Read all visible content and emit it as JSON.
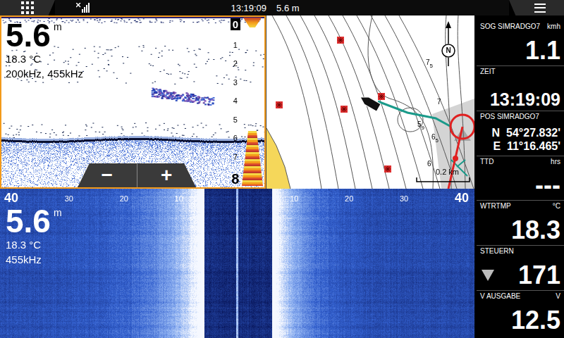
{
  "top_bar": {
    "time": "13:19:09",
    "depth": "5.6 m"
  },
  "sonar_panel": {
    "selected": true,
    "depth": "5.6",
    "depth_unit": "m",
    "water_temp": "18.3 °C",
    "frequency": "200kHz, 455kHz",
    "scale": [
      "0",
      "1",
      "2",
      "3",
      "4",
      "5",
      "6",
      "7",
      "8"
    ],
    "zoom_out": "−",
    "zoom_in": "+"
  },
  "chart_panel": {
    "selected": false,
    "north": "N",
    "soundings": [
      {
        "text": "7",
        "sub": "5"
      },
      {
        "text": "7"
      },
      {
        "text": "5",
        "sub": "9"
      },
      {
        "text": "6",
        "sub": "5"
      },
      {
        "text": "6"
      }
    ],
    "scale_bar": "0.2 km"
  },
  "sidescan_panel": {
    "selected": false,
    "range_left": "40",
    "ticks_left": [
      "30",
      "20",
      "10"
    ],
    "ticks_right": [
      "10",
      "20",
      "30"
    ],
    "range_right": "40",
    "depth": "5.6",
    "depth_unit": "m",
    "water_temp": "18.3 °C",
    "frequency": "455kHz"
  },
  "sidebar": {
    "fields": [
      {
        "label": "SOG SIMRADGO7",
        "unit": "kmh",
        "values": [
          "1.1"
        ],
        "kind": "number"
      },
      {
        "label": "ZEIT",
        "values": [
          "13:19:09"
        ],
        "kind": "time"
      },
      {
        "label": "POS SIMRADGO7",
        "values": [
          "N  54°27.832'",
          "E  11°16.465'"
        ],
        "kind": "position"
      },
      {
        "label": "TTD",
        "unit": "hrs",
        "values": [
          "---"
        ],
        "kind": "number"
      },
      {
        "label": "WTRTMP",
        "unit": "°C",
        "values": [
          "18.3"
        ],
        "kind": "number"
      },
      {
        "label": "STEUERN",
        "values": [
          "171"
        ],
        "kind": "heading"
      },
      {
        "label": "V AUSGABE",
        "unit": "V",
        "values": [
          "12.5"
        ],
        "kind": "number"
      }
    ]
  }
}
